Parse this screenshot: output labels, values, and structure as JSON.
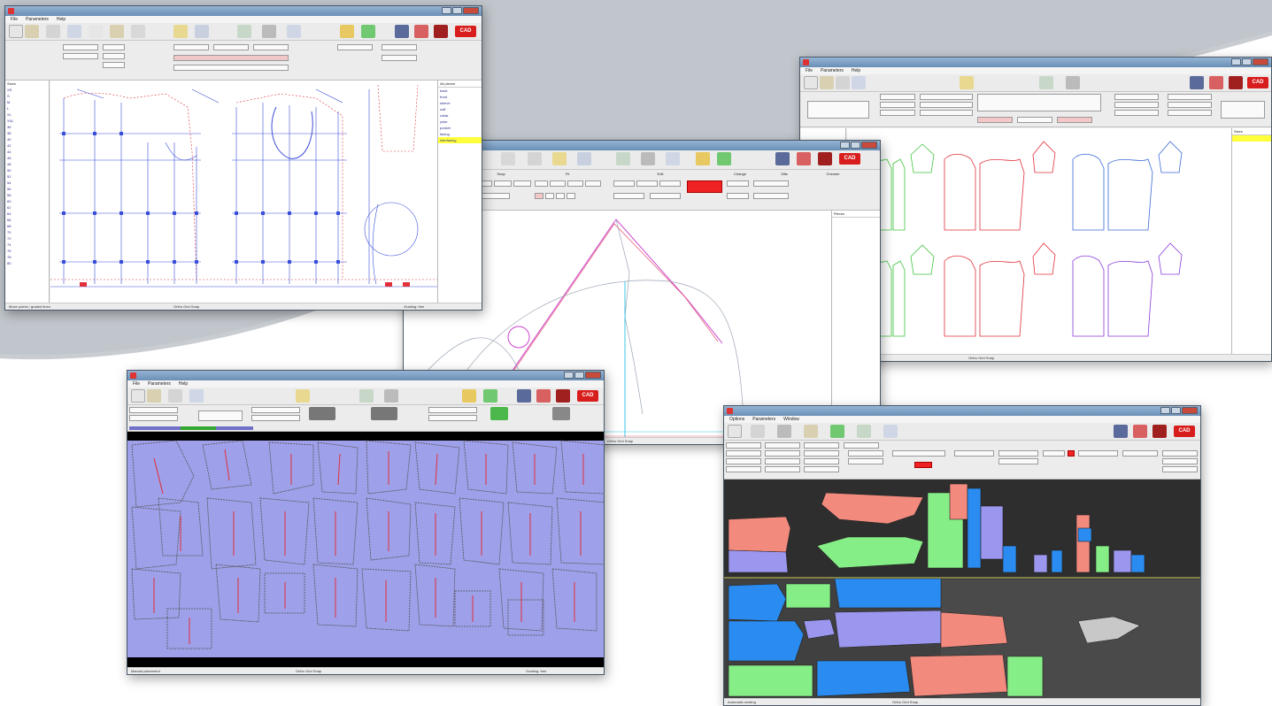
{
  "background": {
    "color_light": "#ffffff",
    "color_band": "#c9cdd2"
  },
  "windows": {
    "pattern_editor": {
      "menu": [
        "File",
        "Parameters",
        "Help"
      ],
      "logo_text": "CAD",
      "left_list_header": "Sizes",
      "left_list": [
        "XS",
        "S",
        "M",
        "L",
        "XL",
        "XXL",
        "36",
        "38",
        "40",
        "42",
        "44",
        "46",
        "48",
        "50",
        "52",
        "54",
        "56",
        "58",
        "60",
        "62",
        "64",
        "66",
        "68",
        "70",
        "72",
        "74",
        "76",
        "78",
        "80"
      ],
      "right_list_header": "All pieces",
      "right_list": [
        "back",
        "front",
        "sleeve",
        "cuff",
        "collar",
        "yoke",
        "pocket",
        "facing",
        "interfacing"
      ],
      "status_left": "Move points / graded lines",
      "status_mid": "Ortho  Grid  Snap",
      "status_right": "Grading: free"
    },
    "curve_editor": {
      "panel_headers": [
        "Snap",
        "Fit",
        "Edit",
        "Change",
        "Slits",
        "Checker"
      ],
      "right_list_header": "Pieces",
      "status_mid": "Ortho  Grid  Snap"
    },
    "size_set": {
      "menu": [
        "File",
        "Parameters",
        "Help"
      ],
      "logo_text": "CAD",
      "right_list_header": "Sizes",
      "status_mid": "Ortho  Grid  Snap"
    },
    "marker_manual": {
      "menu": [
        "File",
        "Parameters",
        "Help"
      ],
      "logo_text": "CAD",
      "status_left": "Manual placement",
      "status_mid": "Ortho  Grid  Snap",
      "status_right": "Grading: free",
      "fabric_color": "#9ea0ea"
    },
    "marker_auto": {
      "menu": [
        "Options",
        "Parameters",
        "Window"
      ],
      "logo_text": "CAD",
      "status_left": "Automatic nesting",
      "status_mid": "Ortho  Grid  Snap"
    }
  },
  "colors": {
    "grade_blue": "#3a4fd8",
    "grade_red": "#e0303a",
    "piece_pink": "#f28a7e",
    "piece_green": "#86ee86",
    "piece_blue": "#2a8cf0",
    "piece_violet": "#9b96ee",
    "piece_gray": "#c8c8c8"
  }
}
